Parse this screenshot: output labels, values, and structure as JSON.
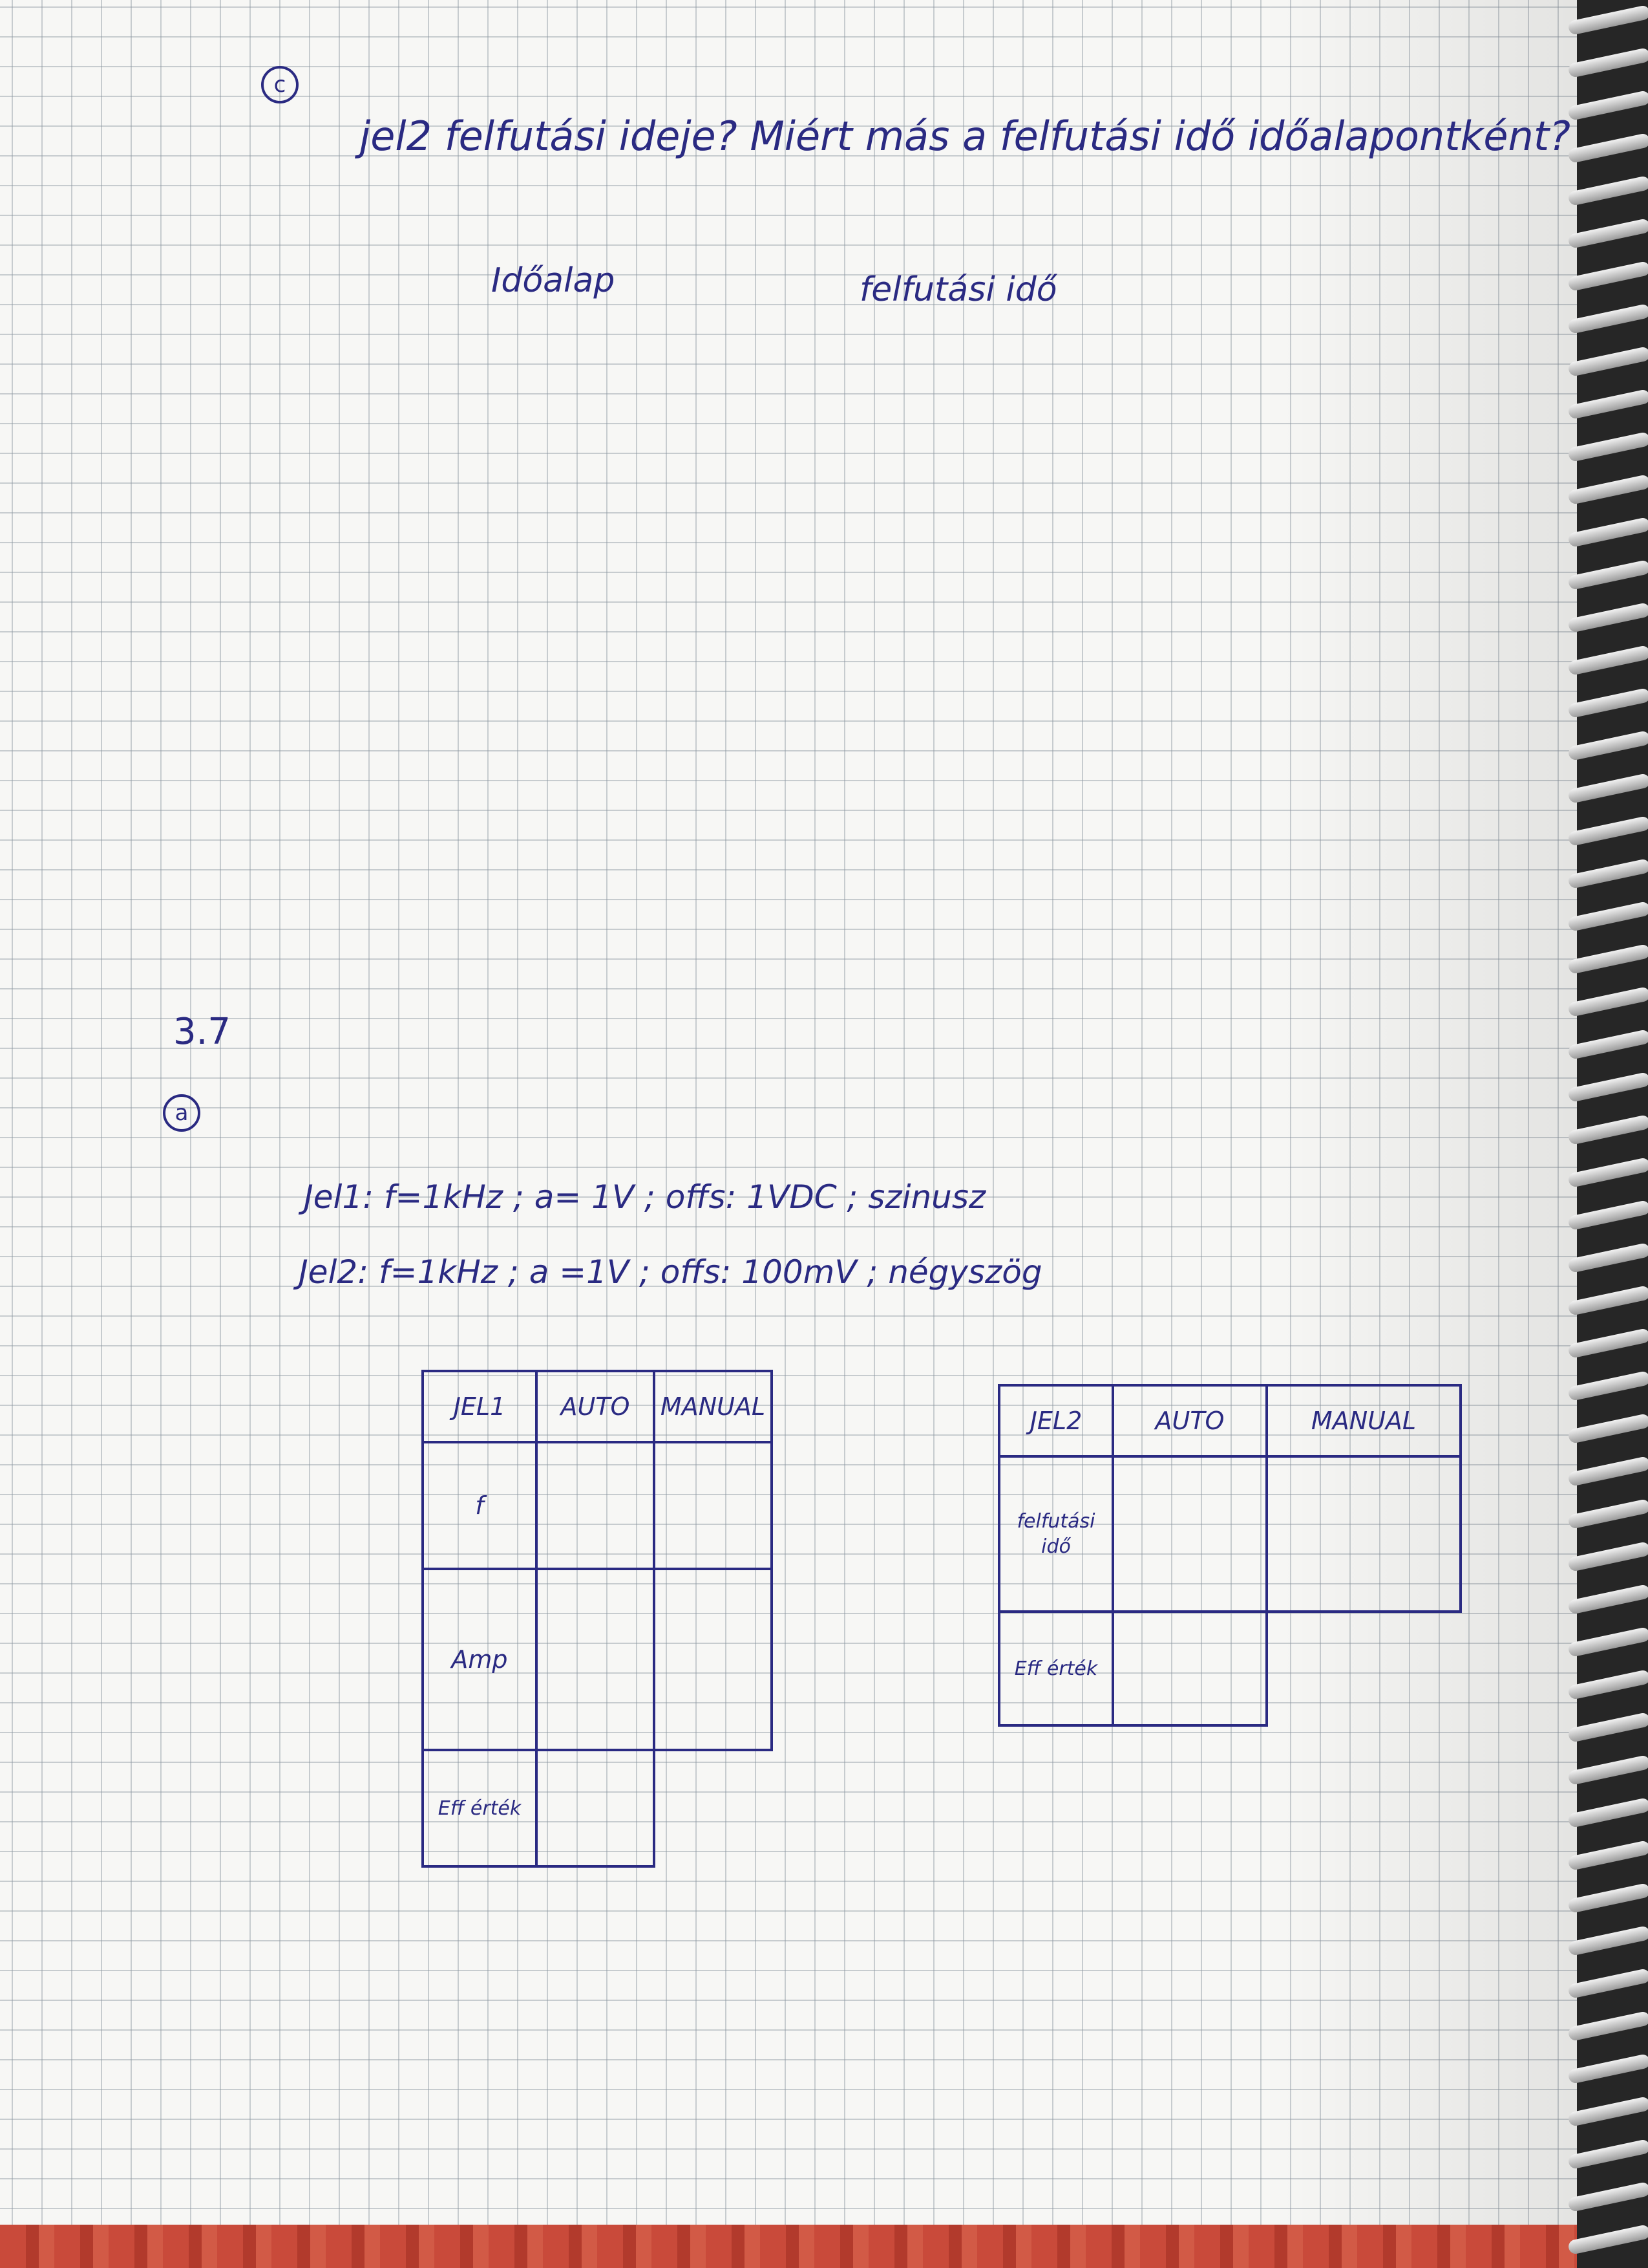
{
  "section_c": {
    "marker": "c",
    "question": "jel2 felfutási ideje? Miért más a felfutási idő időalapontként?",
    "col_left": "Időalap",
    "col_right": "felfutási idő"
  },
  "section_37": {
    "number": "3.7",
    "marker": "a",
    "jel1_line": "Jel1: f=1kHz ; a= 1V ; offs: 1VDC ; szinusz",
    "jel2_line": "Jel2: f=1kHz ; a =1V ; offs: 100mV ; négyszög"
  },
  "table1": {
    "header": [
      "JEL1",
      "AUTO",
      "MANUAL"
    ],
    "rows": [
      "f",
      "Amp",
      "Eff érték"
    ]
  },
  "table2": {
    "header": [
      "JEL2",
      "AUTO",
      "MANUAL"
    ],
    "rows": [
      "felfutási idő",
      "Eff érték"
    ]
  }
}
